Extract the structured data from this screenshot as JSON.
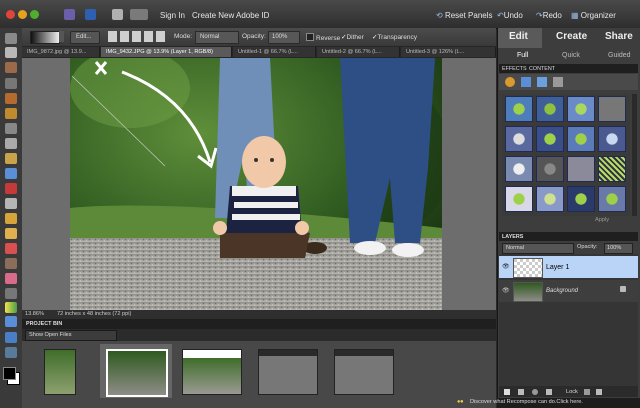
{
  "menubar": {
    "sign_in": "Sign In",
    "create_id": "Create New Adobe ID",
    "reset_panels": "Reset Panels",
    "undo": "Undo",
    "redo": "Redo",
    "organizer": "Organizer"
  },
  "options": {
    "edit": "Edit...",
    "mode_label": "Mode:",
    "mode_value": "Normal",
    "opacity_label": "Opacity:",
    "opacity_value": "100%",
    "reverse": "Reverse",
    "dither": "Dither",
    "transparency": "Transparency"
  },
  "doc_tabs": [
    "IMG_9872.jpg @ 13.9...",
    "IMG_9432.JPG @ 13.9% (Layer 1, RGB/8)",
    "Untitled-1 @ 66.7% (L...",
    "Untitled-2 @ 66.7% (L...",
    "Untitled-3 @ 126% (L..."
  ],
  "status": {
    "zoom": "13.86%",
    "doc_size": "72 inches x 48 inches (72 ppi)"
  },
  "project_bin": {
    "title": "PROJECT BIN",
    "filter": "Show Open Files"
  },
  "right_panel": {
    "tabs": [
      "Edit",
      "Create",
      "Share"
    ],
    "sub_tabs": [
      "Full",
      "Quick",
      "Guided"
    ],
    "effects_tabs": [
      "EFFECTS",
      "CONTENT"
    ],
    "effects_footer": "Apply",
    "layers_title": "LAYERS",
    "blend_mode": "Normal",
    "opacity_label": "Opacity:",
    "opacity_value": "100%",
    "layers": [
      {
        "name": "Layer 1",
        "selected": true
      },
      {
        "name": "Background",
        "selected": false,
        "locked": true
      }
    ],
    "lock_label": "Lock"
  },
  "bottom": {
    "tip": "Discover what Recompose can do.Click here."
  },
  "colors": {
    "accent_blue": "#5a8fd8",
    "selected_layer": "#b9d4f7"
  }
}
